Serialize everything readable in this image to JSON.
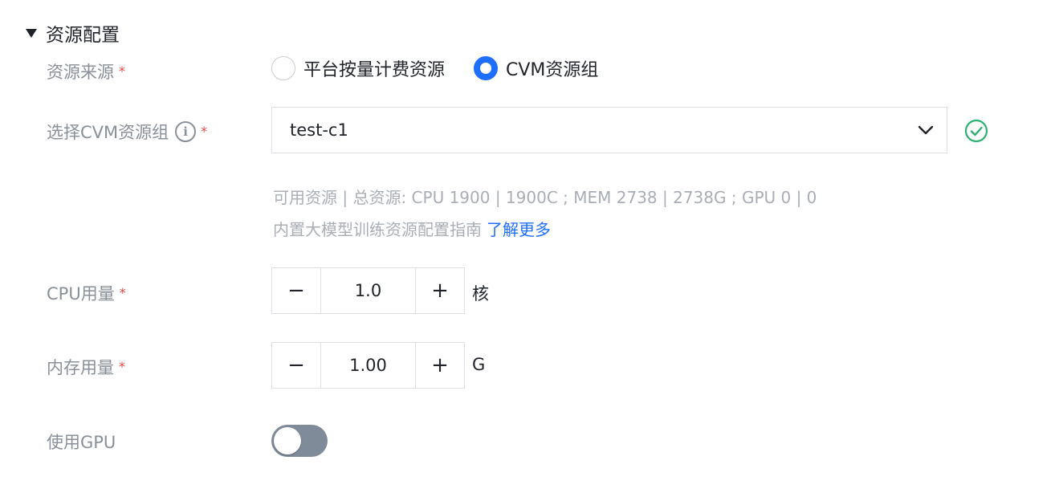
{
  "section": {
    "title": "资源配置"
  },
  "resource_source": {
    "label": "资源来源",
    "required_mark": "*",
    "options": [
      {
        "label": "平台按量计费资源",
        "selected": false
      },
      {
        "label": "CVM资源组",
        "selected": true
      }
    ]
  },
  "cvm_group": {
    "label": "选择CVM资源组",
    "info_glyph": "i",
    "required_mark": "*",
    "value": "test-c1",
    "hint_resources": "可用资源 | 总资源: CPU 1900 | 1900C ; MEM 2738 | 2738G ; GPU 0 | 0",
    "hint_guide": "内置大模型训练资源配置指南",
    "hint_link": "了解更多"
  },
  "cpu": {
    "label": "CPU用量",
    "required_mark": "*",
    "minus": "−",
    "value": "1.0",
    "plus": "+",
    "unit": "核"
  },
  "memory": {
    "label": "内存用量",
    "required_mark": "*",
    "minus": "−",
    "value": "1.00",
    "plus": "+",
    "unit": "G"
  },
  "gpu": {
    "label": "使用GPU",
    "enabled": false
  },
  "colors": {
    "accent": "#1f6fff",
    "success": "#2fb170",
    "required": "#e54545"
  }
}
